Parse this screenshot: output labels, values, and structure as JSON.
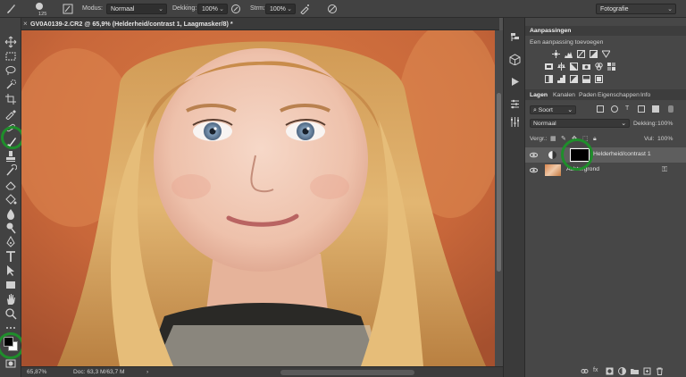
{
  "options_bar": {
    "brush_size": "125",
    "mode_label": "Modus:",
    "mode_value": "Normaal",
    "opacity_label": "Dekking:",
    "opacity_value": "100%",
    "flow_label": "Strm:",
    "flow_value": "100%",
    "workspace_value": "Fotografie"
  },
  "document": {
    "tab_title": "GV0A0139-2.CR2 @ 65,9% (Helderheid/contrast 1, Laagmasker/8) *"
  },
  "status_bar": {
    "zoom": "65,87%",
    "doc_size": "Doc: 63,3 M/63,7 M"
  },
  "adjustments_panel": {
    "title": "Aanpassingen",
    "subtitle": "Een aanpassing toevoegen",
    "icons": [
      "brightness-contrast-icon",
      "levels-icon",
      "curves-icon",
      "exposure-icon",
      "vibrance-icon",
      "hue-saturation-icon",
      "color-balance-icon",
      "black-white-icon",
      "photo-filter-icon",
      "channel-mixer-icon",
      "color-lookup-icon",
      "invert-icon",
      "posterize-icon",
      "threshold-icon",
      "gradient-map-icon",
      "selective-color-icon"
    ]
  },
  "layers_panel": {
    "tabs": [
      "Lagen",
      "Kanalen",
      "Paden",
      "Eigenschappen",
      "Info"
    ],
    "filter_kind": "Soort",
    "blend_mode": "Normaal",
    "opacity_label": "Dekking:",
    "opacity_value": "100%",
    "lock_label": "Vergr.:",
    "fill_label": "Vul:",
    "fill_value": "100%",
    "layers": [
      {
        "name": "Helderheid/contrast 1"
      },
      {
        "name": "Achtergrond"
      }
    ]
  },
  "colors": {
    "highlight_ring": "#1f8e2b",
    "foreground": "#000000",
    "background": "#ffffff"
  }
}
